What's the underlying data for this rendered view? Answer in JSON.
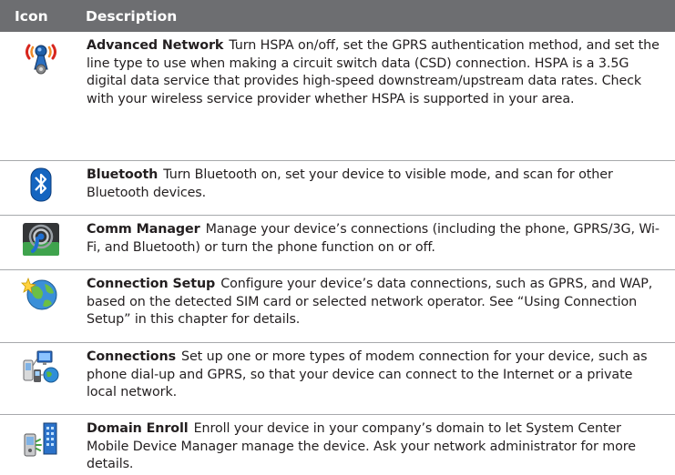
{
  "header": {
    "icon_label": "Icon",
    "description_label": "Description"
  },
  "rows": [
    {
      "icon": "advanced-network-icon",
      "name": "Advanced Network",
      "text": "Turn HSPA on/off, set the GPRS authentication method, and set the line type to use when making a circuit switch data (CSD) connection. HSPA is a 3.5G digital data service that provides high-speed downstream/upstream data rates. Check with your wireless service provider whether HSPA is supported in your area."
    },
    {
      "icon": "bluetooth-icon",
      "name": "Bluetooth",
      "text": "Turn Bluetooth on, set your device to visible mode, and scan for other Bluetooth devices."
    },
    {
      "icon": "comm-manager-icon",
      "name": "Comm Manager",
      "text": "Manage your device’s connections (including the phone, GPRS/3G, Wi-Fi, and Bluetooth) or turn the phone function on or off."
    },
    {
      "icon": "connection-setup-icon",
      "name": "Connection Setup",
      "text": "Configure your device’s data connections, such as GPRS, and WAP, based on the detected SIM card or selected network operator. See “Using Connection Setup” in this chapter for details."
    },
    {
      "icon": "connections-icon",
      "name": "Connections",
      "text": "Set up one or more types of modem connection for your device, such as phone dial-up and GPRS, so that your device can connect to the Internet or a private local network."
    },
    {
      "icon": "domain-enroll-icon",
      "name": "Domain Enroll",
      "text": "Enroll your device in your company’s domain to let System Center Mobile Device Manager manage the device. Ask your network administrator for more details."
    }
  ]
}
